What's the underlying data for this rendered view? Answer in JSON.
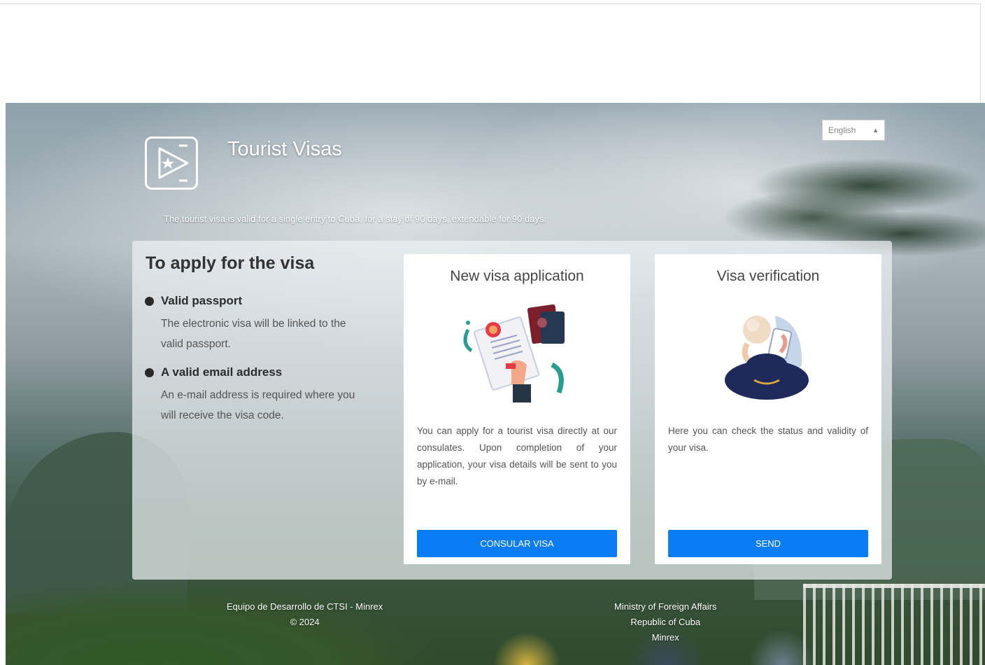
{
  "header": {
    "title": "Tourist Visas",
    "tagline": "The tourist visa is valid for a single entry to Cuba, for a stay of 90 days, extendable for 90 days.",
    "language_selector": "English"
  },
  "requirements": {
    "title": "To apply for the visa",
    "items": [
      {
        "heading": "Valid passport",
        "text": "The electronic visa will be linked to the valid passport."
      },
      {
        "heading": "A valid email address",
        "text": "An e-mail address is required where you will receive the visa code."
      }
    ]
  },
  "cards": {
    "new_application": {
      "title": "New visa application",
      "text": "You can apply for a tourist visa directly at our consulates. Upon completion of your application, your visa details will be sent to you by e-mail.",
      "button": "CONSULAR VISA",
      "illustration_icon": "documents-passport-icon"
    },
    "verification": {
      "title": "Visa verification",
      "text": "Here you can check the status and validity of your visa.",
      "button": "SEND",
      "illustration_icon": "person-phone-icon"
    }
  },
  "footer": {
    "left_line1": "Equipo de Desarrollo de CTSI - Minrex",
    "left_line2": "© 2024",
    "right_line1": "Ministry of Foreign Affairs",
    "right_line2": "Republic of Cuba",
    "right_line3": "Minrex"
  },
  "colors": {
    "primary_button": "#0a7df4",
    "panel_background": "rgba(236,240,242,0.72)",
    "text_dark": "#333333"
  }
}
